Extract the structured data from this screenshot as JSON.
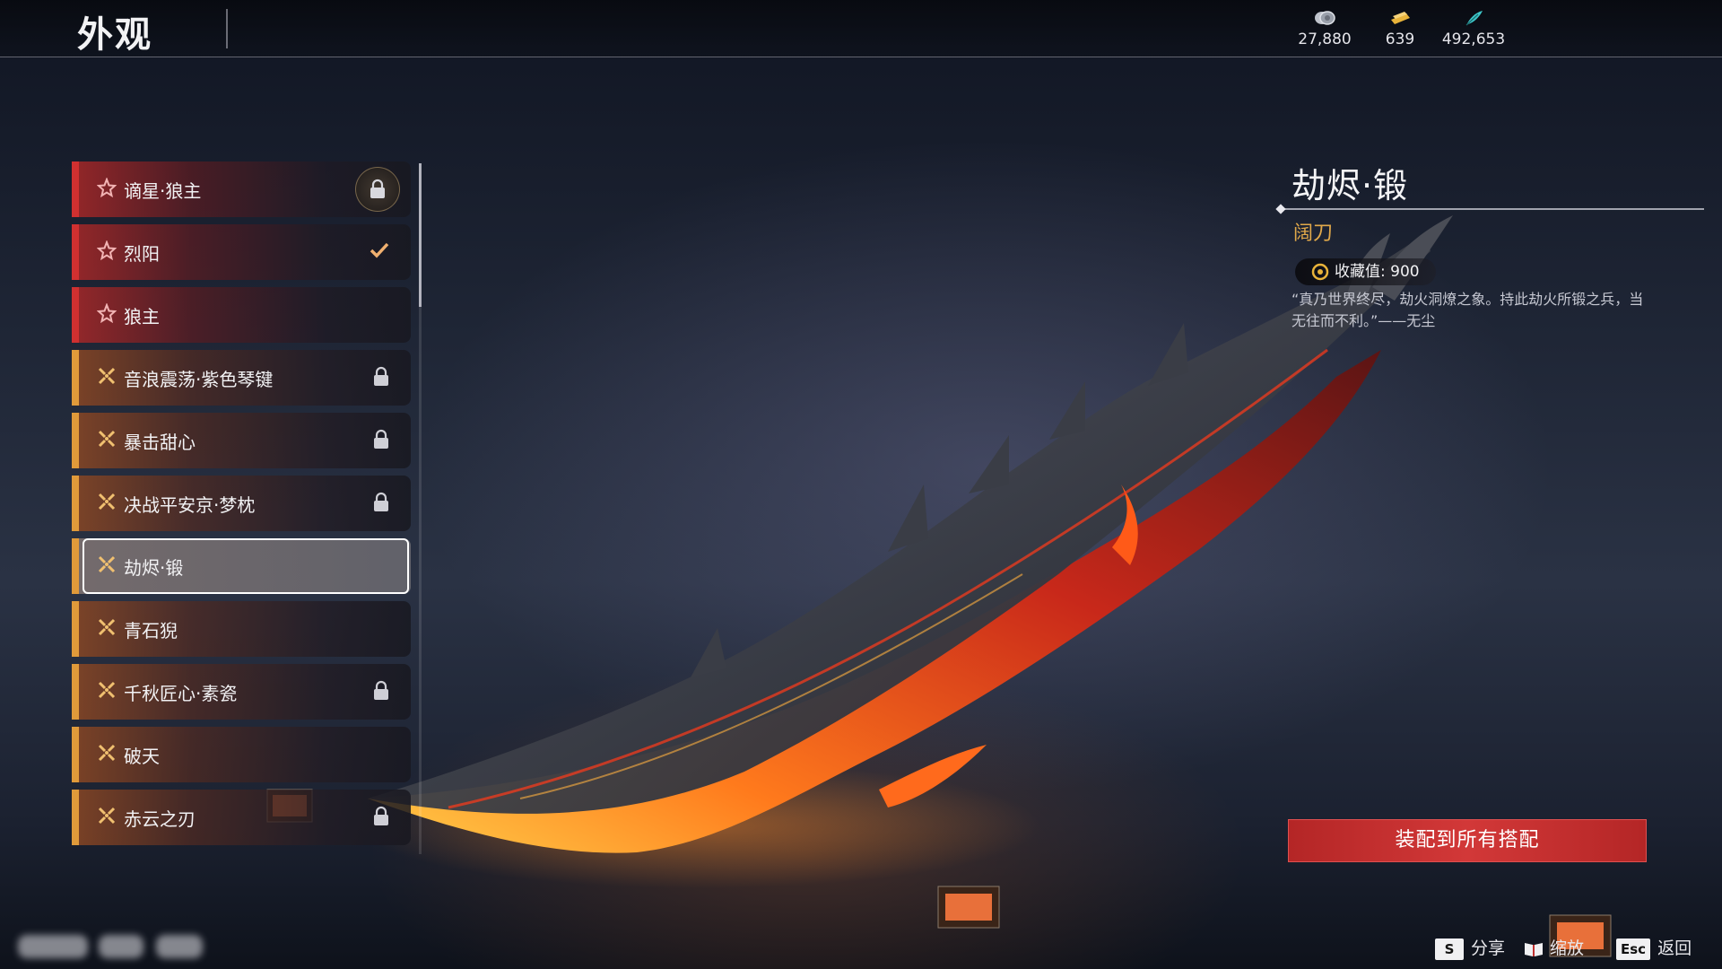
{
  "header": {
    "title": "外观",
    "currencies": [
      {
        "icon": "coin-stack-icon",
        "value": "27,880"
      },
      {
        "icon": "gold-ticket-icon",
        "value": "639"
      },
      {
        "icon": "feather-icon",
        "value": "492,653"
      }
    ]
  },
  "skin_list": {
    "items": [
      {
        "label": "谪星·狼主",
        "rarity": "red",
        "status": "locked-badge"
      },
      {
        "label": "烈阳",
        "rarity": "red",
        "status": "equipped"
      },
      {
        "label": "狼主",
        "rarity": "red",
        "status": "none"
      },
      {
        "label": "音浪震荡·紫色琴键",
        "rarity": "gold",
        "status": "locked"
      },
      {
        "label": "暴击甜心",
        "rarity": "gold",
        "status": "locked"
      },
      {
        "label": "决战平安京·梦枕",
        "rarity": "gold",
        "status": "locked"
      },
      {
        "label": "劫烬·锻",
        "rarity": "gold",
        "status": "selected"
      },
      {
        "label": "青石猊",
        "rarity": "gold",
        "status": "none"
      },
      {
        "label": "千秋匠心·素瓷",
        "rarity": "gold",
        "status": "locked"
      },
      {
        "label": "破天",
        "rarity": "gold",
        "status": "none"
      },
      {
        "label": "赤云之刃",
        "rarity": "gold",
        "status": "locked"
      }
    ]
  },
  "detail": {
    "name": "劫烬·锻",
    "weapon_type": "阔刀",
    "collection_label": "收藏值:",
    "collection_value": "900",
    "description": "“真乃世界终尽，劫火洞燎之象。持此劫火所锻之兵，当无往而不利。”——无尘",
    "equip_all_label": "装配到所有搭配"
  },
  "hints": [
    {
      "key": "S",
      "label": "分享"
    },
    {
      "key": "book-icon",
      "label": "缩放"
    },
    {
      "key": "Esc",
      "label": "返回"
    }
  ],
  "colors": {
    "red_rarity": "#d03030",
    "gold_rarity": "#e09a3a",
    "accent_button": "#c83030",
    "weapon_type_text": "#e2a94a"
  }
}
